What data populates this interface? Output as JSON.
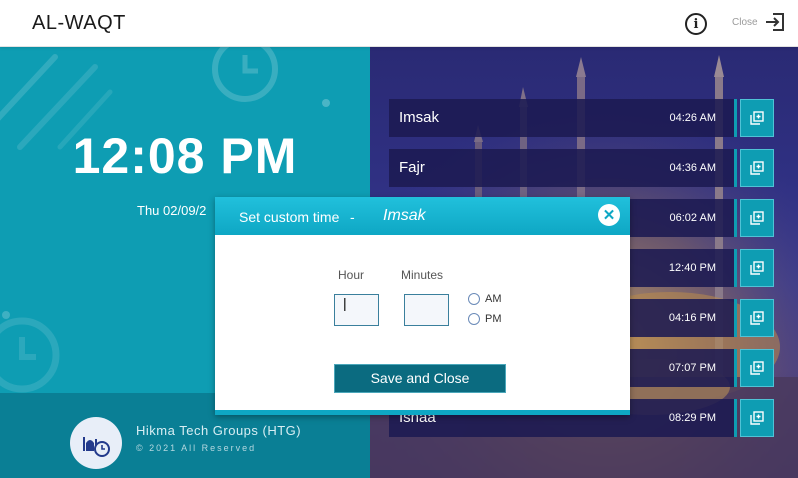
{
  "header": {
    "title": "AL-WAQT",
    "close_label": "Close",
    "info_icon": "info-icon",
    "close_icon": "exit-icon"
  },
  "clock": {
    "time": "12:08 PM",
    "date": "Thu 02/09/2"
  },
  "branding": {
    "name": "Hikma Tech Groups (HTG)",
    "copyright": "© 2021 All Reserved",
    "logo_icon": "mosque-clock-logo"
  },
  "prayers": [
    {
      "name": "Imsak",
      "time": "04:26 AM"
    },
    {
      "name": "Fajr",
      "time": "04:36 AM"
    },
    {
      "name": "",
      "time": "06:02 AM"
    },
    {
      "name": "",
      "time": "12:40 PM"
    },
    {
      "name": "",
      "time": "04:16 PM"
    },
    {
      "name": "",
      "time": "07:07 PM"
    },
    {
      "name": "Ishaa",
      "time": "08:29 PM"
    }
  ],
  "modal": {
    "title": "Set custom time",
    "separator": "-",
    "prayer": "Imsak",
    "hour_label": "Hour",
    "minutes_label": "Minutes",
    "hour_value": "|",
    "minutes_value": "",
    "am_label": "AM",
    "pm_label": "PM",
    "save_label": "Save and Close",
    "close_symbol": "✕"
  },
  "colors": {
    "teal": "#0e9db3",
    "dark_teal": "#0a7f95",
    "button": "#0b6b80",
    "night": "#2a2a74"
  }
}
